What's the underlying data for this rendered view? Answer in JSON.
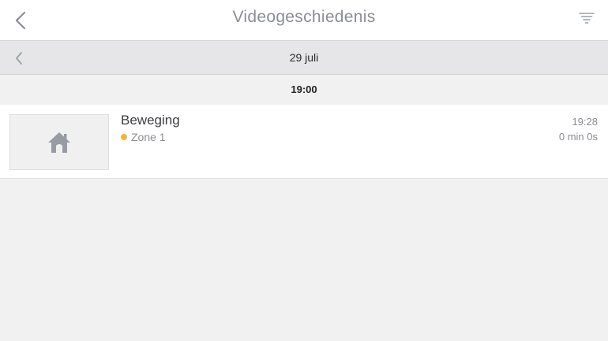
{
  "header": {
    "title": "Videogeschiedenis",
    "back_icon": "chevron-left-icon",
    "filter_icon": "filter-icon"
  },
  "date_bar": {
    "date": "29 juli",
    "prev_icon": "chevron-left-icon"
  },
  "hour_section": {
    "label": "19:00"
  },
  "events": [
    {
      "type": "Beweging",
      "zone": "Zone 1",
      "zone_color": "#f5b335",
      "time": "19:28",
      "duration": "0 min 0s",
      "thumbnail_icon": "house-icon"
    }
  ],
  "colors": {
    "title": "#8a8d94",
    "accent_gray": "#9aa0a8",
    "background": "#f1f1f2"
  }
}
